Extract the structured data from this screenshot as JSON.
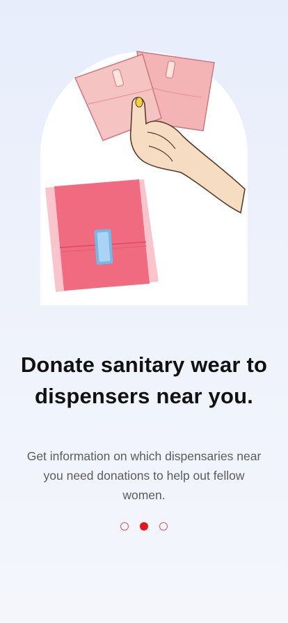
{
  "onboarding": {
    "title": "Donate sanitary wear to dispensers near you.",
    "description": "Get information on which dispensaries near you need donations to help out fellow women."
  },
  "pagination": {
    "count": 3,
    "active_index": 1
  },
  "illustration": {
    "icon": "sanitary-pads-illustration"
  },
  "colors": {
    "accent": "#e8141b",
    "title": "#111111",
    "text": "#5c5c5c"
  }
}
